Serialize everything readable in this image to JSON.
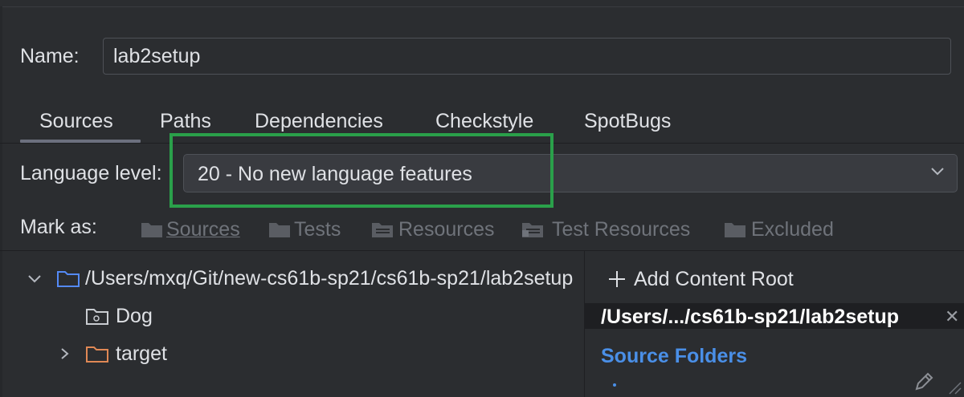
{
  "name": {
    "label": "Name:",
    "value": "lab2setup"
  },
  "tabs": [
    "Sources",
    "Paths",
    "Dependencies",
    "Checkstyle",
    "SpotBugs"
  ],
  "selected_tab": "Sources",
  "language": {
    "label": "Language level:",
    "value": "20 - No new language features"
  },
  "mark_as": {
    "label": "Mark as:",
    "buttons": [
      {
        "label": "Sources",
        "mnemonic": "S",
        "icon": "folder-icon"
      },
      {
        "label": "Tests",
        "mnemonic": "T",
        "icon": "folder-icon"
      },
      {
        "label": "Resources",
        "mnemonic": "",
        "icon": "resources-folder-icon"
      },
      {
        "label": "Test Resources",
        "mnemonic": "",
        "icon": "test-resources-folder-icon"
      },
      {
        "label": "Excluded",
        "mnemonic": "E",
        "icon": "folder-icon"
      }
    ]
  },
  "tree": {
    "root": "/Users/mxq/Git/new-cs61b-sp21/cs61b-sp21/lab2setup",
    "children": [
      {
        "name": "Dog",
        "icon": "package-folder-icon",
        "expandable": false
      },
      {
        "name": "target",
        "icon": "excluded-folder-icon",
        "expandable": true
      }
    ]
  },
  "content_root": {
    "add_label": "Add Content Root",
    "path": "/Users/.../cs61b-sp21/lab2setup",
    "source_folders_label": "Source Folders",
    "source_folder_entry": "."
  },
  "colors": {
    "background": "#2b2d30",
    "highlight_box": "#2aa04a",
    "link_blue": "#4a8fe7",
    "folder_blue": "#548af7",
    "excluded_orange": "#e08855"
  }
}
